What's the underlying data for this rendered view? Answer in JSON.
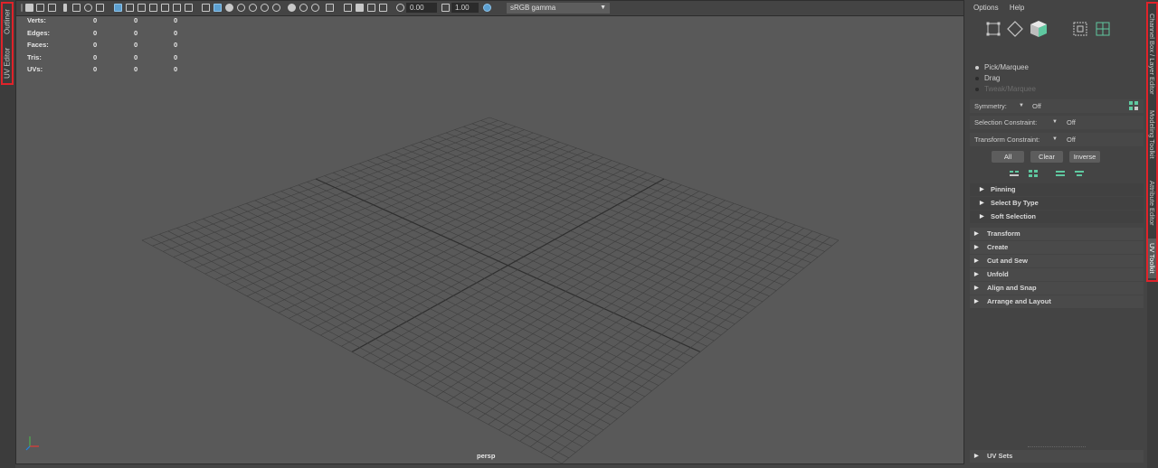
{
  "left_tabs": [
    "Outliner",
    "UV Editor"
  ],
  "viewport": {
    "toolbar": {
      "exposure_value": "0.00",
      "gamma_value": "1.00",
      "color_space": "sRGB gamma"
    },
    "hud": {
      "rows": [
        {
          "label": "Verts:",
          "values": [
            "0",
            "0",
            "0"
          ]
        },
        {
          "label": "Edges:",
          "values": [
            "0",
            "0",
            "0"
          ]
        },
        {
          "label": "Faces:",
          "values": [
            "0",
            "0",
            "0"
          ]
        },
        {
          "label": "Tris:",
          "values": [
            "0",
            "0",
            "0"
          ]
        },
        {
          "label": "UVs:",
          "values": [
            "0",
            "0",
            "0"
          ]
        }
      ]
    },
    "camera_label": "persp"
  },
  "uv_toolkit": {
    "menu": [
      "Options",
      "Help"
    ],
    "selection_modes": [
      {
        "label": "Pick/Marquee",
        "selected": true
      },
      {
        "label": "Drag",
        "selected": false
      },
      {
        "label": "Tweak/Marquee",
        "selected": false,
        "disabled": true
      }
    ],
    "symmetry": {
      "label": "Symmetry:",
      "value": "Off"
    },
    "selection_constraint": {
      "label": "Selection Constraint:",
      "value": "Off"
    },
    "transform_constraint": {
      "label": "Transform Constraint:",
      "value": "Off"
    },
    "buttons": [
      "All",
      "Clear",
      "Inverse"
    ],
    "subsections": [
      "Pinning",
      "Select By Type",
      "Soft Selection"
    ],
    "sections": [
      "Transform",
      "Create",
      "Cut and Sew",
      "Unfold",
      "Align and Snap",
      "Arrange and Layout"
    ],
    "footer_section": "UV Sets"
  },
  "right_tabs": [
    "Channel Box / Layer Editor",
    "Modeling Toolkit",
    "Attribute Editor",
    "UV Toolkit"
  ],
  "colors": {
    "highlight_border": "#e0232a",
    "viewport_bg": "#595959",
    "panel_bg": "#444444",
    "accent_green": "#5fc8a0"
  }
}
